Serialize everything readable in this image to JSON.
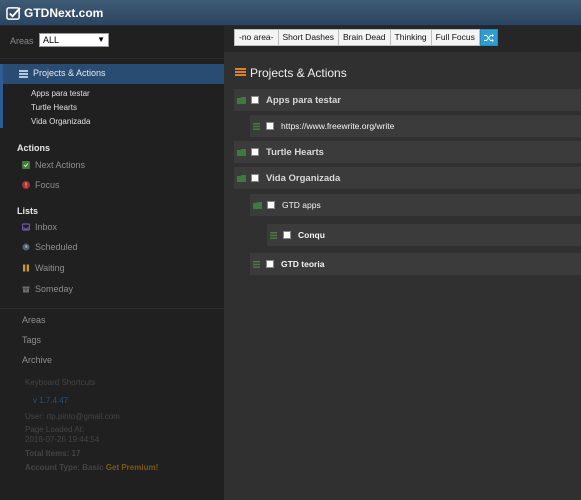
{
  "header": {
    "brand": "GTDNext.com"
  },
  "sidebar": {
    "areas_label": "Areas",
    "areas_value": "ALL",
    "projects_nav": {
      "label": "Projects & Actions",
      "items": [
        "Apps para testar",
        "Turtle Hearts",
        "Vida Organizada"
      ]
    },
    "actions_title": "Actions",
    "actions": [
      {
        "label": "Next Actions",
        "icon": "next-actions-icon",
        "color": "#3f7a3a"
      },
      {
        "label": "Focus",
        "icon": "focus-icon",
        "color": "#a83232"
      }
    ],
    "lists_title": "Lists",
    "lists": [
      {
        "label": "Inbox",
        "icon": "inbox-icon",
        "color": "#6b5aa8"
      },
      {
        "label": "Scheduled",
        "icon": "clock-icon",
        "color": "#55606e"
      },
      {
        "label": "Waiting",
        "icon": "pause-icon",
        "color": "#c89a2a"
      },
      {
        "label": "Someday",
        "icon": "archive-box-icon",
        "color": "#6b6b6b"
      }
    ],
    "bottom": [
      "Areas",
      "Tags",
      "Archive"
    ],
    "footer": {
      "shortcuts": "Keyboard Shortcuts",
      "version": "v 1.7.4.47",
      "user": "User: rtp.pinto@gmail.com",
      "page_loaded_label": "Page Loaded At:",
      "page_loaded_value": "2016-07-26 19:44:54",
      "total_items": "Total Items: 17",
      "account_type": "Account Type: Basic",
      "premium": "Get Premium!"
    }
  },
  "main": {
    "filters": [
      "-no area-",
      "Short Dashes",
      "Brain Dead",
      "Thinking",
      "Full Focus"
    ],
    "shuffle_icon": "shuffle-icon",
    "title": "Projects & Actions",
    "rows": [
      {
        "label": "Apps para testar",
        "kind": "project"
      },
      {
        "label": "https://www.freewrite.org/write",
        "kind": "action"
      },
      {
        "label": "Turtle Hearts",
        "kind": "project"
      },
      {
        "label": "Vida Organizada",
        "kind": "project"
      },
      {
        "label": "GTD apps",
        "kind": "subproject"
      },
      {
        "label": "Conqu",
        "kind": "action"
      },
      {
        "label": "GTD teoria",
        "kind": "action"
      }
    ]
  },
  "colors": {
    "header_bg": "#34506d",
    "sidebar_bg": "#202020",
    "active_nav": "#294c73",
    "main_bg": "#303030",
    "row_bg": "#3b3b3b",
    "accent": "#2c9ed2",
    "orange": "#d9822b"
  }
}
